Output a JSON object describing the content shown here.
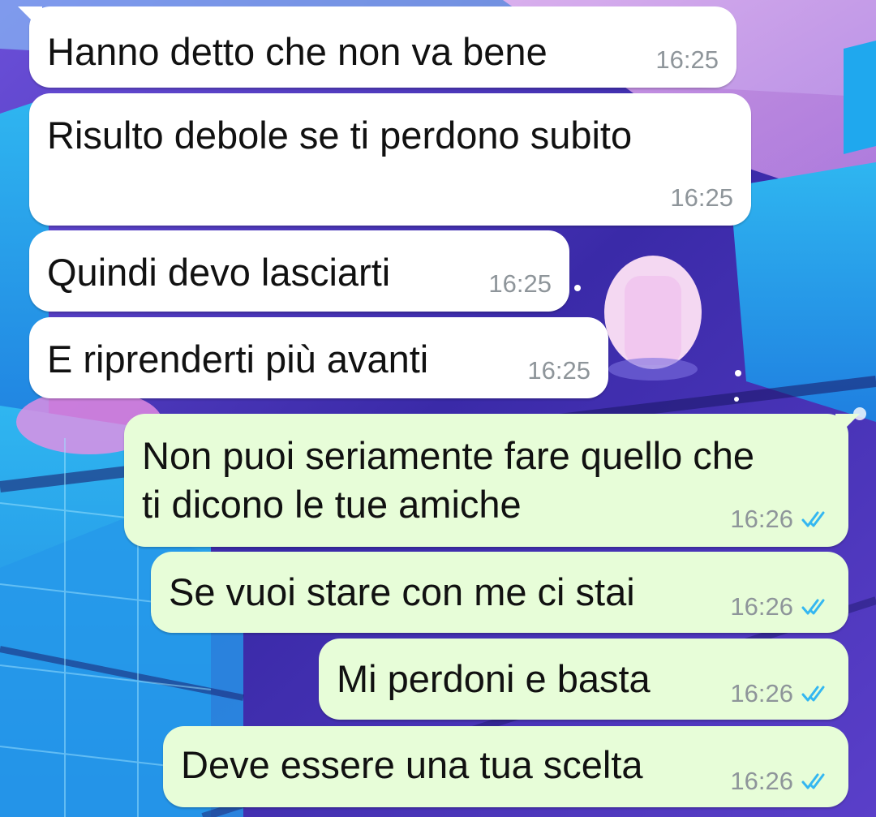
{
  "theme": {
    "incoming_bubble": "#ffffff",
    "outgoing_bubble": "#e7fdd8",
    "read_tick_color": "#34b7f1",
    "wallpaper_primary": "#3b2fb8",
    "wallpaper_accent": "#25c4f2"
  },
  "messages": [
    {
      "direction": "incoming",
      "text": "Hanno detto che non va bene",
      "time": "16:25"
    },
    {
      "direction": "incoming",
      "text": "Risulto debole se ti perdono subito",
      "time": "16:25"
    },
    {
      "direction": "incoming",
      "text": "Quindi devo lasciarti",
      "time": "16:25"
    },
    {
      "direction": "incoming",
      "text": "E riprenderti più avanti",
      "time": "16:25"
    },
    {
      "direction": "outgoing",
      "text": "Non puoi seriamente fare quello che\nti dicono le tue amiche",
      "time": "16:26",
      "status": "read",
      "status_icon": "double-check-icon"
    },
    {
      "direction": "outgoing",
      "text": "Se vuoi stare con me ci stai",
      "time": "16:26",
      "status": "read",
      "status_icon": "double-check-icon"
    },
    {
      "direction": "outgoing",
      "text": "Mi perdoni e basta",
      "time": "16:26",
      "status": "read",
      "status_icon": "double-check-icon"
    },
    {
      "direction": "outgoing",
      "text": "Deve essere una tua scelta",
      "time": "16:26",
      "status": "read",
      "status_icon": "double-check-icon"
    }
  ]
}
